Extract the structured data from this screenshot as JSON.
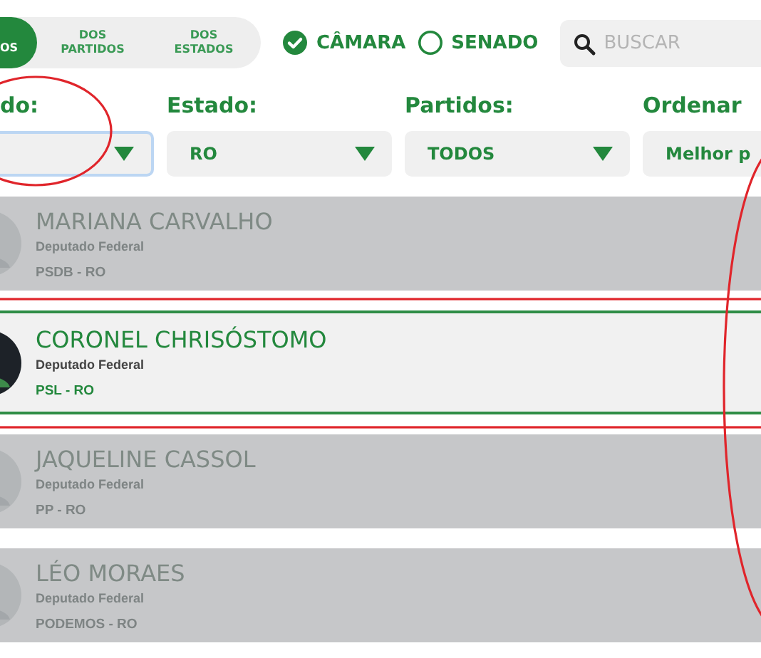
{
  "tabs": [
    {
      "label": "OS",
      "selected": true
    },
    {
      "label": "DOS PARTIDOS",
      "selected": false
    },
    {
      "label": "DOS ESTADOS",
      "selected": false
    }
  ],
  "houses": [
    {
      "label": "CÂMARA",
      "selected": true
    },
    {
      "label": "SENADO",
      "selected": false
    }
  ],
  "search": {
    "placeholder": "BUSCAR"
  },
  "filters": [
    {
      "label": "do:",
      "focused": true
    },
    {
      "label": "Estado:",
      "value": "RO",
      "focused": false
    },
    {
      "label": "Partidos:",
      "value": "TODOS",
      "focused": false
    },
    {
      "label": "Ordenar",
      "value": "Melhor p",
      "focused": false
    }
  ],
  "politicians": [
    {
      "name": "MARIANA CARVALHO",
      "role": "Deputado Federal",
      "party": "PSDB - RO",
      "dimmed": true
    },
    {
      "name": "CORONEL CHRISÓSTOMO",
      "role": "Deputado Federal",
      "party": "PSL - RO",
      "dimmed": false
    },
    {
      "name": "JAQUELINE CASSOL",
      "role": "Deputado Federal",
      "party": "PP - RO",
      "dimmed": true
    },
    {
      "name": "LÉO MORAES",
      "role": "Deputado Federal",
      "party": "PODEMOS - RO",
      "dimmed": true
    }
  ],
  "annotations": [
    {
      "kind": "ellipse"
    },
    {
      "kind": "ellipse"
    },
    {
      "kind": "rectangle"
    }
  ]
}
